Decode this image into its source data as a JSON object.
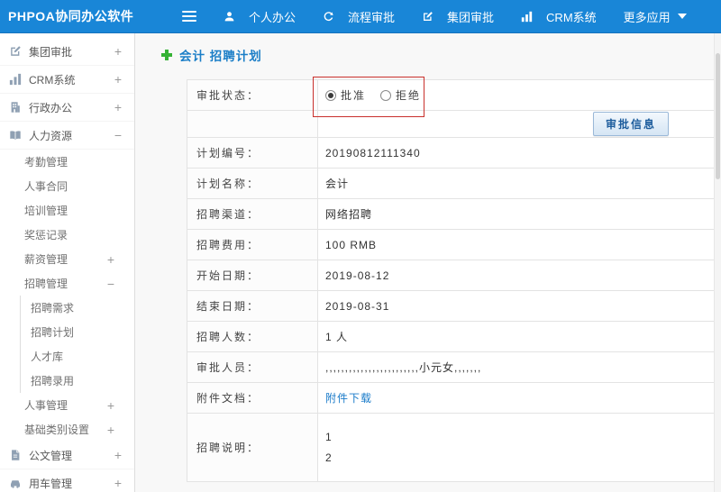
{
  "topbar": {
    "logo": "PHPOA协同办公软件",
    "nav": [
      {
        "label": "个人办公",
        "icon": "person"
      },
      {
        "label": "流程审批",
        "icon": "process-arrow"
      },
      {
        "label": "集团审批",
        "icon": "edit-square"
      },
      {
        "label": "CRM系统",
        "icon": "bar-chart"
      },
      {
        "label": "更多应用",
        "icon": "caret-down"
      }
    ]
  },
  "sidebar": {
    "items": [
      {
        "label": "集团审批",
        "toggle": "+",
        "icon": "edit-square"
      },
      {
        "label": "CRM系统",
        "toggle": "+",
        "icon": "bar-chart"
      },
      {
        "label": "行政办公",
        "toggle": "+",
        "icon": "building"
      },
      {
        "label": "人力资源",
        "toggle": "−",
        "icon": "open-book"
      },
      {
        "label": "考勤管理",
        "toggle": ""
      },
      {
        "label": "人事合同",
        "toggle": ""
      },
      {
        "label": "培训管理",
        "toggle": ""
      },
      {
        "label": "奖惩记录",
        "toggle": ""
      },
      {
        "label": "薪资管理",
        "toggle": "+"
      },
      {
        "label": "招聘管理",
        "toggle": "−"
      },
      {
        "label": "招聘需求",
        "toggle": ""
      },
      {
        "label": "招聘计划",
        "toggle": ""
      },
      {
        "label": "人才库",
        "toggle": ""
      },
      {
        "label": "招聘录用",
        "toggle": ""
      },
      {
        "label": "人事管理",
        "toggle": "+"
      },
      {
        "label": "基础类别设置",
        "toggle": "+"
      },
      {
        "label": "公文管理",
        "toggle": "+",
        "icon": "document"
      },
      {
        "label": "用车管理",
        "toggle": "+",
        "icon": "car"
      }
    ]
  },
  "main": {
    "title": "会计 招聘计划",
    "form": {
      "status_label": "审批状态：",
      "radio_approve": "批准",
      "radio_reject": "拒绝",
      "approve_button": "审批信息",
      "rows": [
        {
          "label": "计划编号：",
          "value": "20190812111340"
        },
        {
          "label": "计划名称：",
          "value": "会计"
        },
        {
          "label": "招聘渠道：",
          "value": "网络招聘"
        },
        {
          "label": "招聘费用：",
          "value": "100 RMB"
        },
        {
          "label": "开始日期：",
          "value": "2019-08-12"
        },
        {
          "label": "结束日期：",
          "value": "2019-08-31"
        },
        {
          "label": "招聘人数：",
          "value": "1 人"
        },
        {
          "label": "审批人员：",
          "value": ",,,,,,,,,,,,,,,,,,,,,,,,小元女,,,,,,,"
        },
        {
          "label": "附件文档：",
          "value": "附件下载"
        },
        {
          "label": "招聘说明：",
          "line1": "1",
          "line2": "2"
        }
      ]
    }
  },
  "colors": {
    "topbar_blue": "#1986d7",
    "title_blue": "#1b7ec7",
    "plus_green": "#35b235",
    "link_blue": "#1a7bc9",
    "annotation_red": "#c9302c",
    "button_text_blue": "#1c5c9c"
  }
}
